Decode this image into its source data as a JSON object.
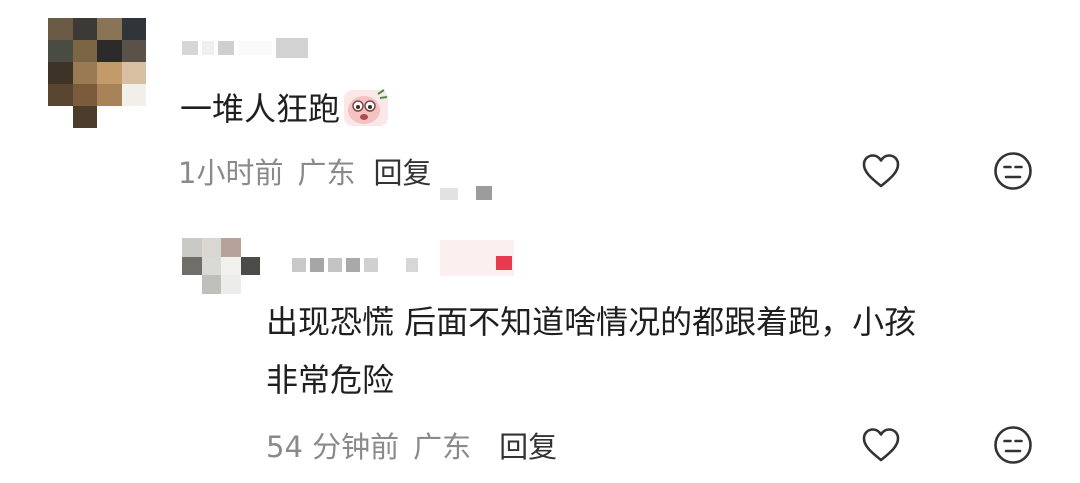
{
  "comments": [
    {
      "text": "一堆人狂跑",
      "emoji": "sticker-emoji",
      "time": "1小时前",
      "location": "广东",
      "reply_label": "回复"
    },
    {
      "text_line1": "出现恐慌 后面不知道啥情况的都跟着跑，小孩",
      "text_line2": "非常危险",
      "time": "54 分钟前",
      "location": "广东",
      "reply_label": "回复"
    }
  ],
  "icons": {
    "like": "heart-icon",
    "dislike": "meh-face-icon"
  },
  "colors": {
    "meta_text": "#8a8a8a",
    "reply_text": "#333333",
    "icon_stroke": "#333333",
    "badge_red": "#e83a4f"
  }
}
